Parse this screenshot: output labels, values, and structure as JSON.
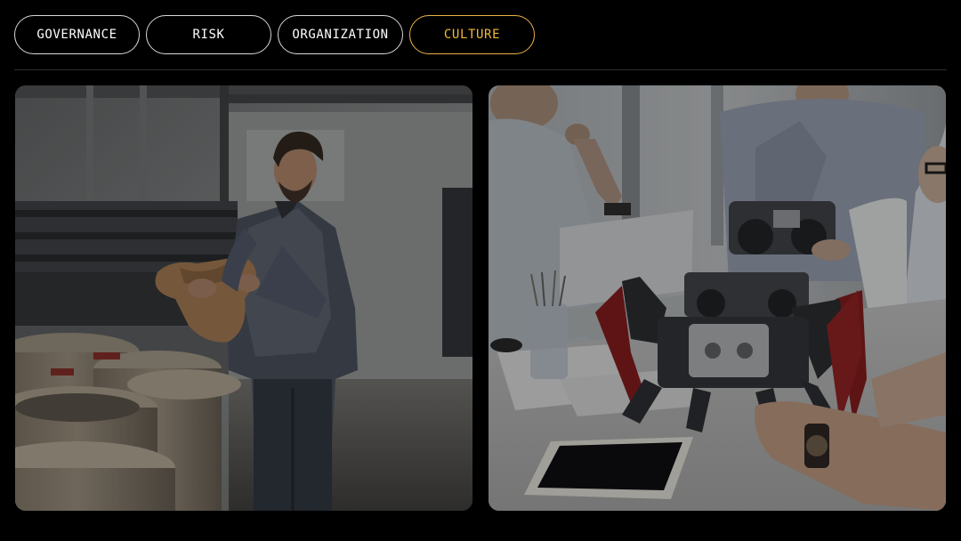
{
  "tabs": [
    {
      "label": "GOVERNANCE",
      "active": false
    },
    {
      "label": "RISK",
      "active": false
    },
    {
      "label": "ORGANIZATION",
      "active": false
    },
    {
      "label": "CULTURE",
      "active": true
    }
  ],
  "accent_color": "#f0b93a",
  "images": [
    {
      "name": "factory-worker-photo"
    },
    {
      "name": "robotics-team-photo"
    }
  ]
}
